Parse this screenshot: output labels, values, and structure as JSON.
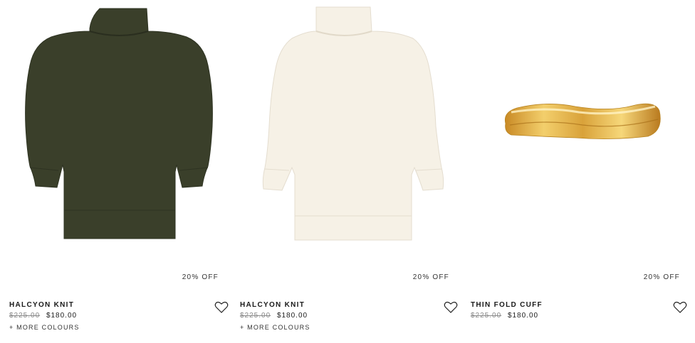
{
  "products": [
    {
      "name": "HALCYON KNIT",
      "discount": "20% OFF",
      "price_was": "$225.00",
      "price_now": "$180.00",
      "more_colours": "+ MORE COLOURS",
      "image": "olive-turtleneck-knit",
      "color": "#3a3f2a"
    },
    {
      "name": "HALCYON KNIT",
      "discount": "20% OFF",
      "price_was": "$225.00",
      "price_now": "$180.00",
      "more_colours": "+ MORE COLOURS",
      "image": "ivory-turtleneck-knit",
      "color": "#f6f1e6"
    },
    {
      "name": "THIN FOLD CUFF",
      "discount": "20% OFF",
      "price_was": "$225.00",
      "price_now": "$180.00",
      "image": "gold-cuff-bracelet",
      "color": "#d9a23a"
    }
  ],
  "icons": {
    "wishlist": "heart-outline-icon"
  }
}
